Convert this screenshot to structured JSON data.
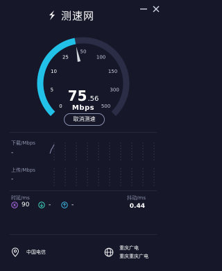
{
  "app": {
    "title": "测速网"
  },
  "speed": {
    "integer": "75",
    "decimal": ".56",
    "unit": "Mbps"
  },
  "gauge": {
    "ticks": [
      "0",
      "5",
      "10",
      "25",
      "50",
      "100",
      "150",
      "300",
      "500"
    ],
    "progress_fraction": 0.46,
    "accent": "#22c2e8",
    "track": "#2a2d45"
  },
  "actions": {
    "cancel_label": "取消测速"
  },
  "download": {
    "label": "下载/Mbps",
    "value": "-"
  },
  "upload": {
    "label": "上传/Mbps",
    "value": "-"
  },
  "latency": {
    "label": "时延/ms",
    "ping": "90",
    "down": "-",
    "up": "-"
  },
  "jitter": {
    "label": "抖动/ms",
    "value": "0.44"
  },
  "isp": {
    "local": "中国电信",
    "server_line1": "重庆广电",
    "server_line2": "重庆重庆广电"
  }
}
